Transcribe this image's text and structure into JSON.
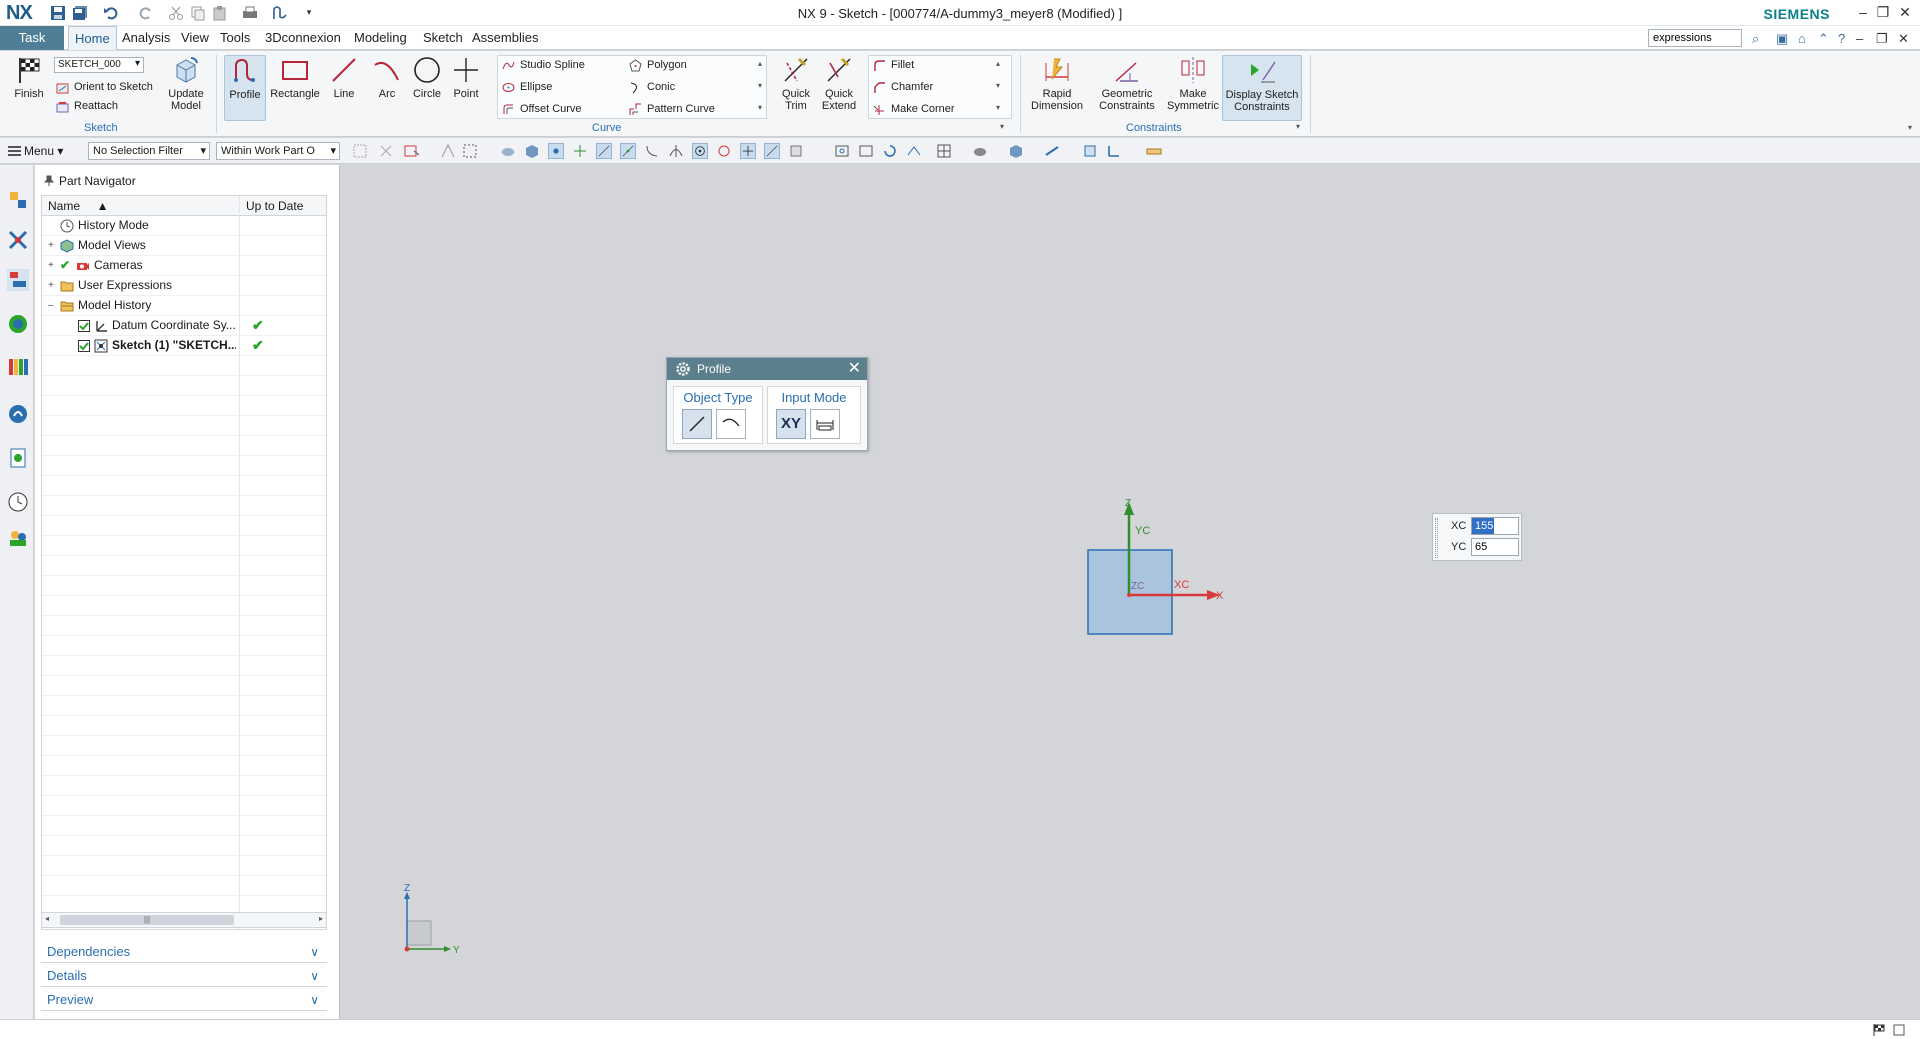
{
  "titlebar": {
    "logo": "NX",
    "title": "NX 9 - Sketch - [000774/A-dummy3_meyer8 (Modified) ]",
    "brand": "SIEMENS"
  },
  "tabs": {
    "task": "Task",
    "items": [
      "Home",
      "Analysis",
      "View",
      "Tools",
      "3Dconnexion",
      "Modeling",
      "Sketch",
      "Assemblies"
    ],
    "active": "Home",
    "command_search_value": "expressions"
  },
  "ribbon": {
    "sketch_group": {
      "label": "Sketch",
      "finish": "Finish",
      "sketch_name": "SKETCH_000",
      "orient": "Orient to Sketch",
      "reattach": "Reattach",
      "update": "Update Model"
    },
    "curve_group": {
      "label": "Curve",
      "profile": "Profile",
      "rectangle": "Rectangle",
      "line": "Line",
      "arc": "Arc",
      "circle": "Circle",
      "point": "Point",
      "studio_spline": "Studio Spline",
      "ellipse": "Ellipse",
      "offset_curve": "Offset Curve",
      "polygon": "Polygon",
      "conic": "Conic",
      "pattern_curve": "Pattern Curve",
      "quick_trim": "Quick Trim",
      "quick_extend": "Quick Extend",
      "fillet": "Fillet",
      "chamfer": "Chamfer",
      "make_corner": "Make Corner"
    },
    "constraints_group": {
      "label": "Constraints",
      "rapid_dimension": "Rapid Dimension",
      "geometric_constraints": "Geometric Constraints",
      "make_symmetric": "Make Symmetric",
      "display_sketch_constraints": "Display Sketch Constraints"
    }
  },
  "selection_toolbar": {
    "menu": "Menu",
    "filter": "No Selection Filter",
    "scope": "Within Work Part O"
  },
  "navigator": {
    "title": "Part Navigator",
    "col_name": "Name",
    "col_uptodate": "Up to Date",
    "rows": [
      {
        "label": "History Mode",
        "check": false
      },
      {
        "label": "Model Views",
        "check": false
      },
      {
        "label": "Cameras",
        "check": false
      },
      {
        "label": "User Expressions",
        "check": false
      },
      {
        "label": "Model History",
        "check": false
      },
      {
        "label": "Datum Coordinate Sy...",
        "check": true
      },
      {
        "label": "Sketch (1) \"SKETCH...",
        "check": true
      }
    ],
    "dependencies": "Dependencies",
    "details": "Details",
    "preview": "Preview"
  },
  "profile_dialog": {
    "title": "Profile",
    "object_type": "Object Type",
    "input_mode": "Input Mode",
    "xy": "XY"
  },
  "coords": {
    "xc_label": "XC",
    "yc_label": "YC",
    "xc_value": "155",
    "yc_value": "65"
  },
  "axes": {
    "z": "Z",
    "yc": "YC",
    "zc": "ZC",
    "xc": "XC",
    "x": "X",
    "mini_z": "Z",
    "mini_y": "Y"
  },
  "colors": {
    "task_tab": "#4f7f96",
    "accent": "#2a6eb0",
    "dialog_header": "#5b7f8c",
    "sketch_fill": "#a9c4dc",
    "x_axis": "#d63a3a",
    "y_axis": "#2f8f2f"
  }
}
